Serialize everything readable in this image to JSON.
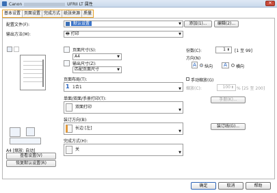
{
  "window": {
    "title_prefix": "Canon",
    "title_suffix": "UFRII LT 属性"
  },
  "tabs": [
    {
      "label": "基本设置"
    },
    {
      "label": "页面设置"
    },
    {
      "label": "完成方式"
    },
    {
      "label": "纸张来源"
    },
    {
      "label": "质量"
    }
  ],
  "profile": {
    "label": "配置文件(F):",
    "value": "默认设置",
    "add_label": "添加(1)...",
    "edit_label": "编辑(2)..."
  },
  "output": {
    "label": "输出方法(M):",
    "value": "打印"
  },
  "page_size": {
    "label": "页面尺寸(S):",
    "value": "A4"
  },
  "output_size": {
    "label": "输出尺寸(Z):",
    "value": "匹配页面尺寸"
  },
  "copies": {
    "label": "份数(C):",
    "value": "1",
    "range": "[1 至 99]"
  },
  "orientation": {
    "label": "方向(N)",
    "portrait": "纵向",
    "landscape": "横向",
    "portrait_glyph": "A",
    "landscape_glyph": "A"
  },
  "layout": {
    "label": "页面布局(T):",
    "value": "1合1",
    "glyph": "1"
  },
  "manual_scaling": {
    "label": "手动缩放(G)",
    "scale_label": "缩放(C):",
    "value": "100",
    "range": "% [25 至 200]"
  },
  "watermark_btn": "手册(K)...",
  "duplex": {
    "label": "单面/双面/手册打印(T):",
    "value": "双面打印"
  },
  "binding": {
    "label": "装订方向(B):",
    "value": "长边 [左]",
    "button": "装订线(G)..."
  },
  "finishing": {
    "label": "完成方式(H):",
    "value": "关"
  },
  "preview": {
    "info": "A4 [缩放: 自动]",
    "view_settings": "查看设置(V)",
    "restore_defaults": "恢复默认设置(R)"
  },
  "dialog": {
    "ok": "确定",
    "cancel": "取消",
    "help": "帮助"
  }
}
